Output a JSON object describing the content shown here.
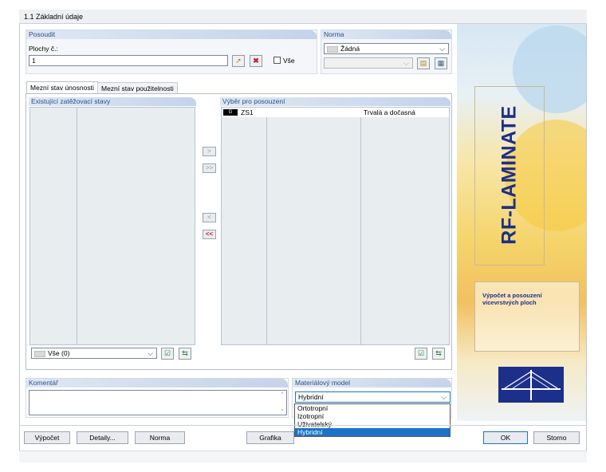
{
  "window": {
    "title": "1.1 Základní údaje"
  },
  "posoudit": {
    "header": "Posoudit",
    "label": "Plochy č.:",
    "value": "1",
    "vse_label": "Vše"
  },
  "norma": {
    "header": "Norma",
    "value": "Žádná"
  },
  "tabs": [
    {
      "label": "Mezní stav únosnosti"
    },
    {
      "label": "Mezní stav použitelnosti"
    }
  ],
  "existing": {
    "header": "Existující zatěžovací stavy",
    "filter_value": "Vše (0)"
  },
  "selection": {
    "header": "Výběr pro posouzení",
    "rows": [
      {
        "badge": "G",
        "id": "ZS1",
        "type": "Trvalá a dočasná"
      }
    ]
  },
  "transfer": {
    "add_one": ">",
    "add_all": ">>",
    "remove_one": "<",
    "remove_all": "<<"
  },
  "comment": {
    "header": "Komentář",
    "value": ""
  },
  "material": {
    "header": "Materiálový model",
    "value": "Hybridní",
    "options": [
      "Ortotropní",
      "Izotropní",
      "Uživatelský",
      "Hybridní"
    ],
    "selected_index": 3
  },
  "banner": {
    "title": "RF-LAMINATE",
    "subtitle_line1": "Výpočet a posouzení",
    "subtitle_line2": "vícevrstvých ploch"
  },
  "footer": {
    "vypocet": "Výpočet",
    "detaily": "Detaily...",
    "norma": "Norma",
    "grafika": "Grafika",
    "ok": "OK",
    "storno": "Storno"
  },
  "colors": {
    "accent": "#1a73c9",
    "banner_text": "#1c2f8a",
    "delete_red": "#c8202b"
  }
}
